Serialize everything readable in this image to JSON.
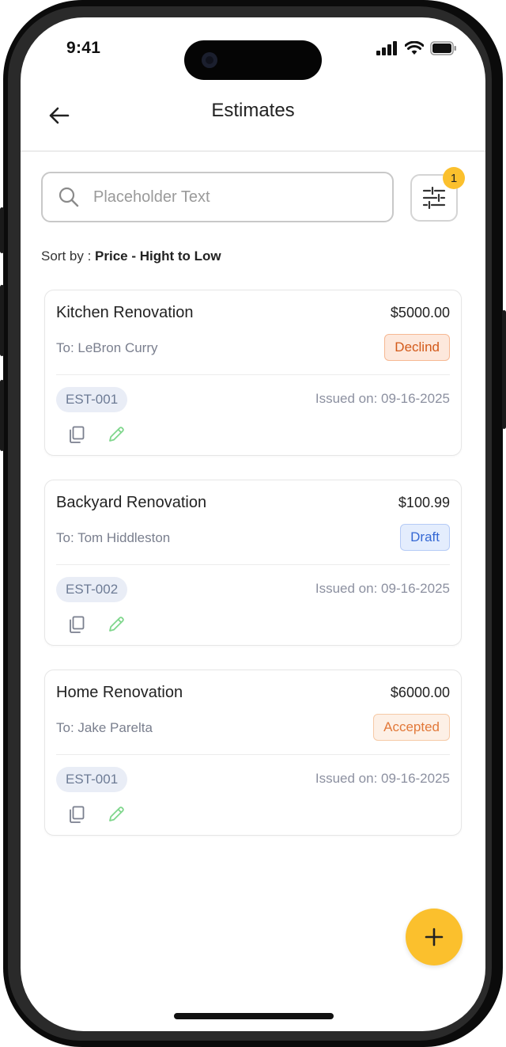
{
  "status_bar": {
    "time": "9:41"
  },
  "header": {
    "title": "Estimates"
  },
  "search": {
    "placeholder": "Placeholder Text",
    "value": ""
  },
  "filter": {
    "badge_count": "1"
  },
  "sort": {
    "label": "Sort by : ",
    "value": "Price - Hight to Low"
  },
  "estimates": [
    {
      "name": "Kitchen Renovation",
      "price": "$5000.00",
      "to": "To: LeBron Curry",
      "status": "Declind",
      "id": "EST-001",
      "issued": "Issued on: 09-16-2025"
    },
    {
      "name": "Backyard Renovation",
      "price": "$100.99",
      "to": "To: Tom Hiddleston",
      "status": "Draft",
      "id": "EST-002",
      "issued": "Issued on: 09-16-2025"
    },
    {
      "name": "Home Renovation",
      "price": "$6000.00",
      "to": "To: Jake Parelta",
      "status": "Accepted",
      "id": "EST-001",
      "issued": "Issued on: 09-16-2025"
    }
  ],
  "colors": {
    "accent": "#fbc02d",
    "declined": "#d35a1a",
    "draft": "#3568d4",
    "accepted": "#e2793a",
    "edit_icon": "#7fd68c"
  },
  "icons": {
    "back": "arrow-left-icon",
    "search": "search-icon",
    "filter": "sliders-icon",
    "copy": "copy-icon",
    "edit": "pencil-icon",
    "fab": "plus-icon"
  }
}
